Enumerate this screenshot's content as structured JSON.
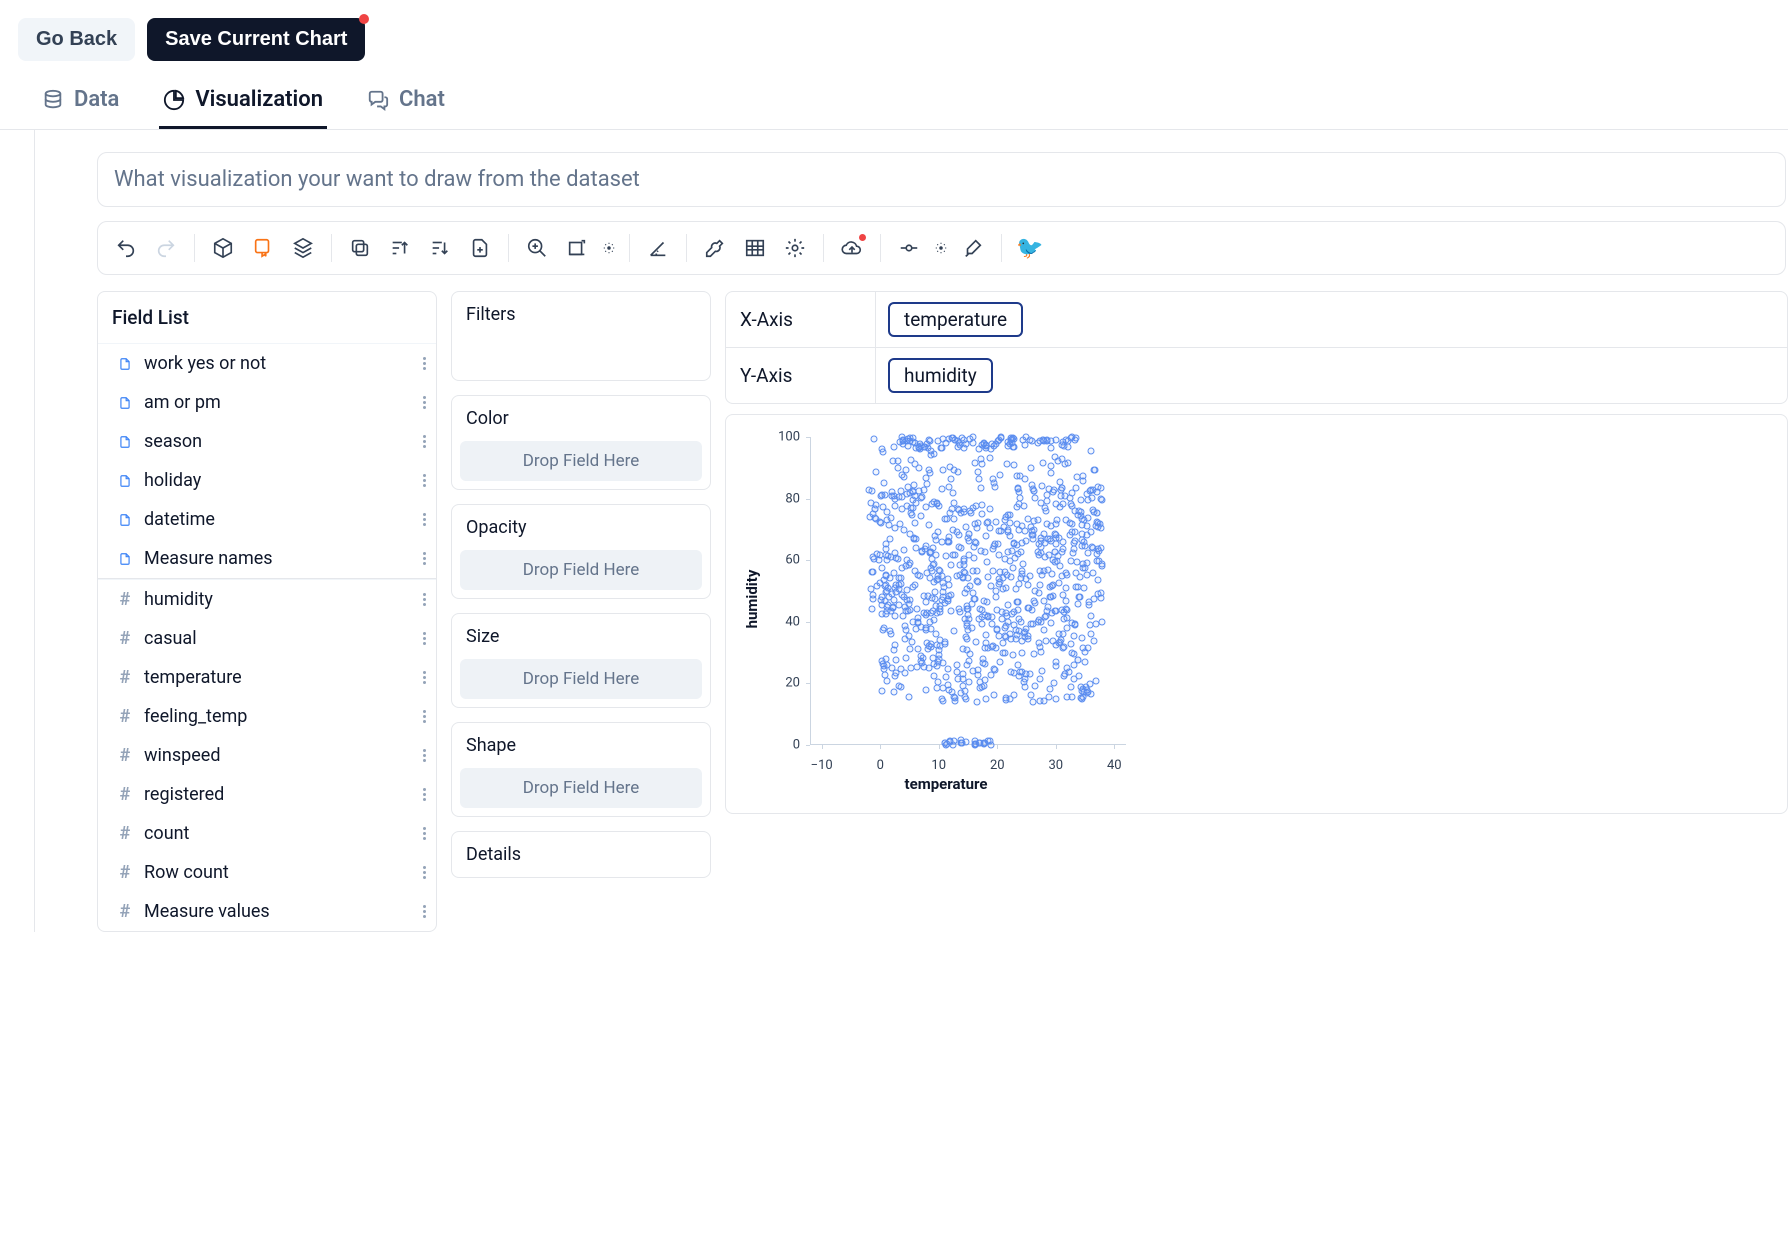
{
  "header": {
    "back": "Go Back",
    "save": "Save Current Chart"
  },
  "tabs": {
    "data": "Data",
    "viz": "Visualization",
    "chat": "Chat"
  },
  "prompt_placeholder": "What visualization your want to draw from the dataset",
  "panels": {
    "field_list_title": "Field List",
    "filters": "Filters",
    "color": "Color",
    "opacity": "Opacity",
    "size": "Size",
    "shape": "Shape",
    "details": "Details",
    "dropzone": "Drop Field Here"
  },
  "fields_dim": [
    "work yes or not",
    "am or pm",
    "season",
    "holiday",
    "datetime",
    "Measure names"
  ],
  "fields_meas": [
    "humidity",
    "casual",
    "temperature",
    "feeling_temp",
    "winspeed",
    "registered",
    "count",
    "Row count",
    "Measure values"
  ],
  "axes": {
    "x_label": "X-Axis",
    "y_label": "Y-Axis",
    "x_value": "temperature",
    "y_value": "humidity"
  },
  "chart_data": {
    "type": "scatter",
    "xlabel": "temperature",
    "ylabel": "humidity",
    "xlim": [
      -12,
      42
    ],
    "ylim": [
      0,
      100
    ],
    "xticks": [
      -10,
      0,
      10,
      20,
      30,
      40
    ],
    "yticks": [
      0,
      20,
      40,
      60,
      80,
      100
    ],
    "note": "dense point cloud; many overlapping points between x≈0..38 and y≈15..100, with a small cluster at y≈0 around x≈12..18 and an isolated low-humidity group near x≈35, y≈17"
  }
}
